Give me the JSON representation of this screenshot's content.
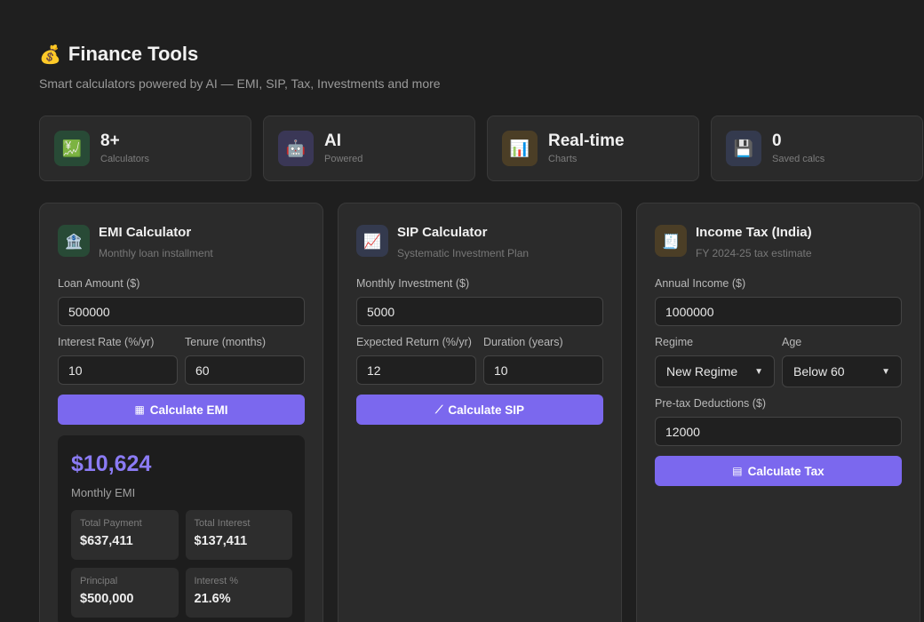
{
  "header": {
    "icon": "money-bag-icon",
    "title": "Finance Tools",
    "subtitle": "Smart calculators powered by AI — EMI, SIP, Tax, Investments and more"
  },
  "stats": [
    {
      "icon": "chart-up-icon",
      "value": "8+",
      "label": "Calculators",
      "color": "#284a36"
    },
    {
      "icon": "robot-icon",
      "value": "AI",
      "label": "Powered",
      "color": "#3a3756"
    },
    {
      "icon": "bar-chart-icon",
      "value": "Real-time",
      "label": "Charts",
      "color": "#4b3e26"
    },
    {
      "icon": "floppy-icon",
      "value": "0",
      "label": "Saved calcs",
      "color": "#343a4e"
    }
  ],
  "emi": {
    "title": "EMI Calculator",
    "subtitle": "Monthly loan installment",
    "loan_label": "Loan Amount ($)",
    "loan_value": "500000",
    "rate_label": "Interest Rate (%/yr)",
    "rate_value": "10",
    "tenure_label": "Tenure (months)",
    "tenure_value": "60",
    "button": "Calculate EMI",
    "result": {
      "amount": "$10,624",
      "caption": "Monthly EMI",
      "tiles": [
        {
          "label": "Total Payment",
          "value": "$637,411"
        },
        {
          "label": "Total Interest",
          "value": "$137,411"
        },
        {
          "label": "Principal",
          "value": "$500,000"
        },
        {
          "label": "Interest %",
          "value": "21.6%"
        }
      ]
    }
  },
  "sip": {
    "title": "SIP Calculator",
    "subtitle": "Systematic Investment Plan",
    "monthly_label": "Monthly Investment ($)",
    "monthly_value": "5000",
    "return_label": "Expected Return (%/yr)",
    "return_value": "12",
    "duration_label": "Duration (years)",
    "duration_value": "10",
    "button": "Calculate SIP"
  },
  "tax": {
    "title": "Income Tax (India)",
    "subtitle": "FY 2024-25 tax estimate",
    "income_label": "Annual Income ($)",
    "income_value": "1000000",
    "regime_label": "Regime",
    "regime_value": "New Regime",
    "age_label": "Age",
    "age_value": "Below 60",
    "deductions_label": "Pre-tax Deductions ($)",
    "deductions_value": "12000",
    "button": "Calculate Tax"
  }
}
